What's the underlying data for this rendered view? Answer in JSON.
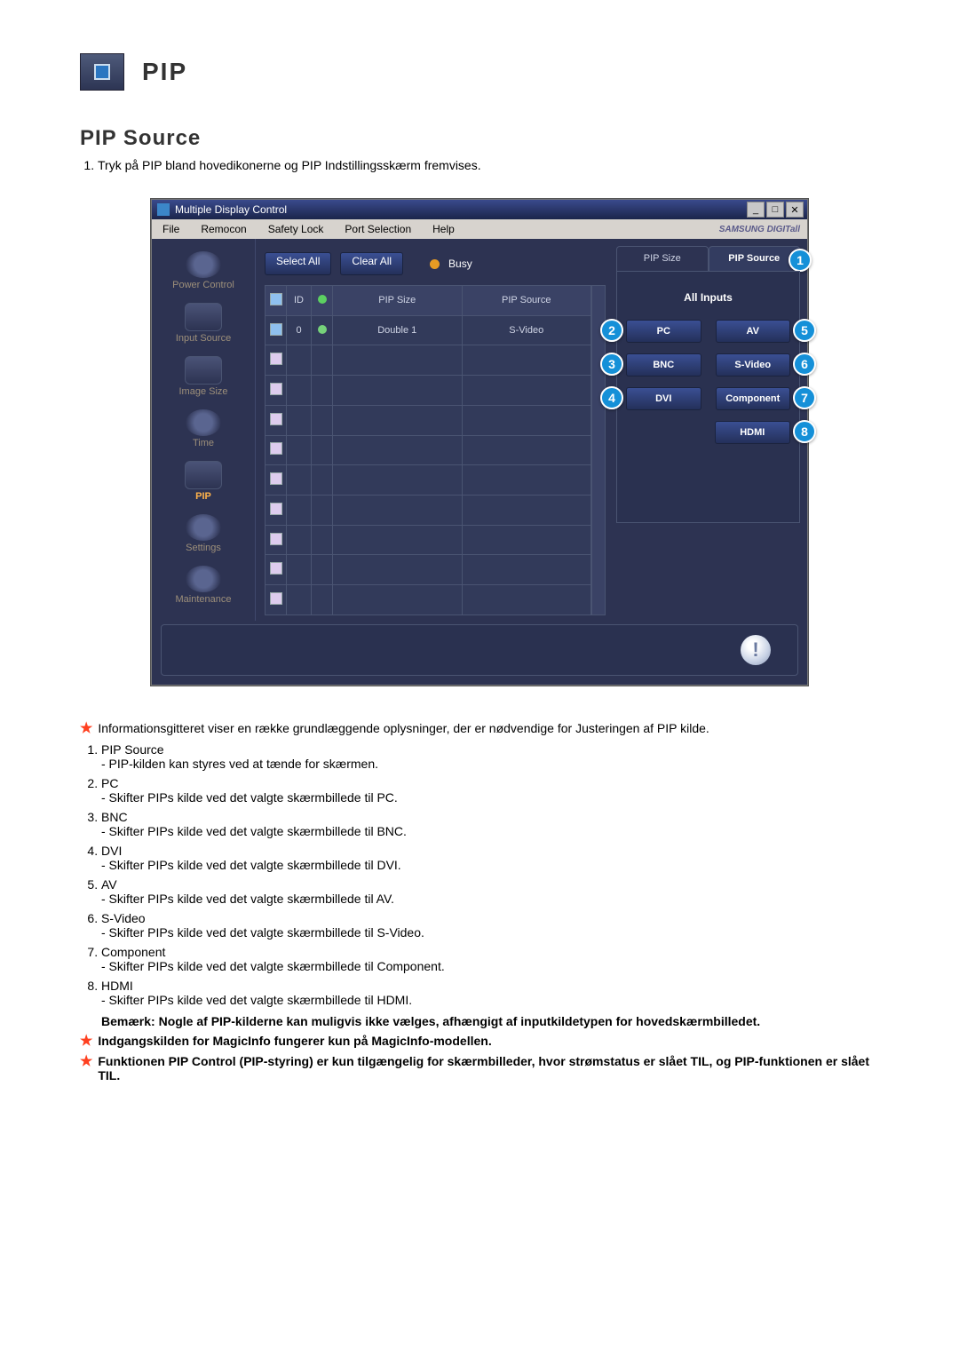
{
  "page_title_icon_name": "pip-icon",
  "page_title": "PIP",
  "section_heading": "PIP Source",
  "step_1": "Tryk på PIP bland hovedikonerne og PIP Indstillingsskærm fremvises.",
  "window": {
    "title": "Multiple Display Control",
    "min_label": "_",
    "max_label": "□",
    "close_label": "✕",
    "menus": {
      "file": "File",
      "remocon": "Remocon",
      "safety_lock": "Safety Lock",
      "port_selection": "Port Selection",
      "help": "Help"
    },
    "brand": "SAMSUNG DIGITall",
    "sidebar": {
      "power_control": "Power Control",
      "input_source": "Input Source",
      "image_size": "Image Size",
      "time": "Time",
      "pip": "PIP",
      "settings": "Settings",
      "maintenance": "Maintenance"
    },
    "toolbar": {
      "select_all": "Select All",
      "clear_all": "Clear All",
      "busy": "Busy"
    },
    "grid": {
      "col_id": "ID",
      "col_pip_size": "PIP Size",
      "col_pip_source": "PIP Source",
      "row0": {
        "id": "0",
        "pip_size": "Double 1",
        "pip_source": "S-Video"
      }
    },
    "right_panel": {
      "tab_size": "PIP Size",
      "tab_source": "PIP Source",
      "heading": "All Inputs",
      "buttons": {
        "pc": "PC",
        "bnc": "BNC",
        "dvi": "DVI",
        "av": "AV",
        "svideo": "S-Video",
        "component": "Component",
        "hdmi": "HDMI"
      },
      "callouts": {
        "c1": "1",
        "c2": "2",
        "c3": "3",
        "c4": "4",
        "c5": "5",
        "c6": "6",
        "c7": "7",
        "c8": "8"
      }
    },
    "info_icon": "!"
  },
  "note_intro": "Informationsgitteret viser en række grundlæggende oplysninger, der er nødvendige for Justeringen af PIP kilde.",
  "items": {
    "i1": {
      "title": "PIP Source",
      "desc": "- PIP-kilden kan styres ved at tænde for skærmen."
    },
    "i2": {
      "title": "PC",
      "desc": "- Skifter PIPs kilde ved det valgte skærmbillede til PC."
    },
    "i3": {
      "title": "BNC",
      "desc": "- Skifter PIPs kilde ved det valgte skærmbillede til BNC."
    },
    "i4": {
      "title": "DVI",
      "desc": "- Skifter PIPs kilde ved det valgte skærmbillede til DVI."
    },
    "i5": {
      "title": "AV",
      "desc": "- Skifter PIPs kilde ved det valgte skærmbillede til AV."
    },
    "i6": {
      "title": "S-Video",
      "desc": "- Skifter PIPs kilde ved det valgte skærmbillede til S-Video."
    },
    "i7": {
      "title": "Component",
      "desc": "- Skifter PIPs kilde ved det valgte skærmbillede til Component."
    },
    "i8": {
      "title": "HDMI",
      "desc": "- Skifter PIPs kilde ved det valgte skærmbillede til HDMI."
    }
  },
  "note_line": "Bemærk: Nogle af PIP-kilderne kan muligvis ikke vælges, afhængigt af inputkildetypen for hovedskærmbilledet.",
  "star_note_2": "Indgangskilden for MagicInfo fungerer kun på MagicInfo-modellen.",
  "star_note_3": "Funktionen PIP Control (PIP-styring) er kun tilgængelig for skærmbilleder, hvor strømstatus er slået TIL, og PIP-funktionen er slået TIL."
}
